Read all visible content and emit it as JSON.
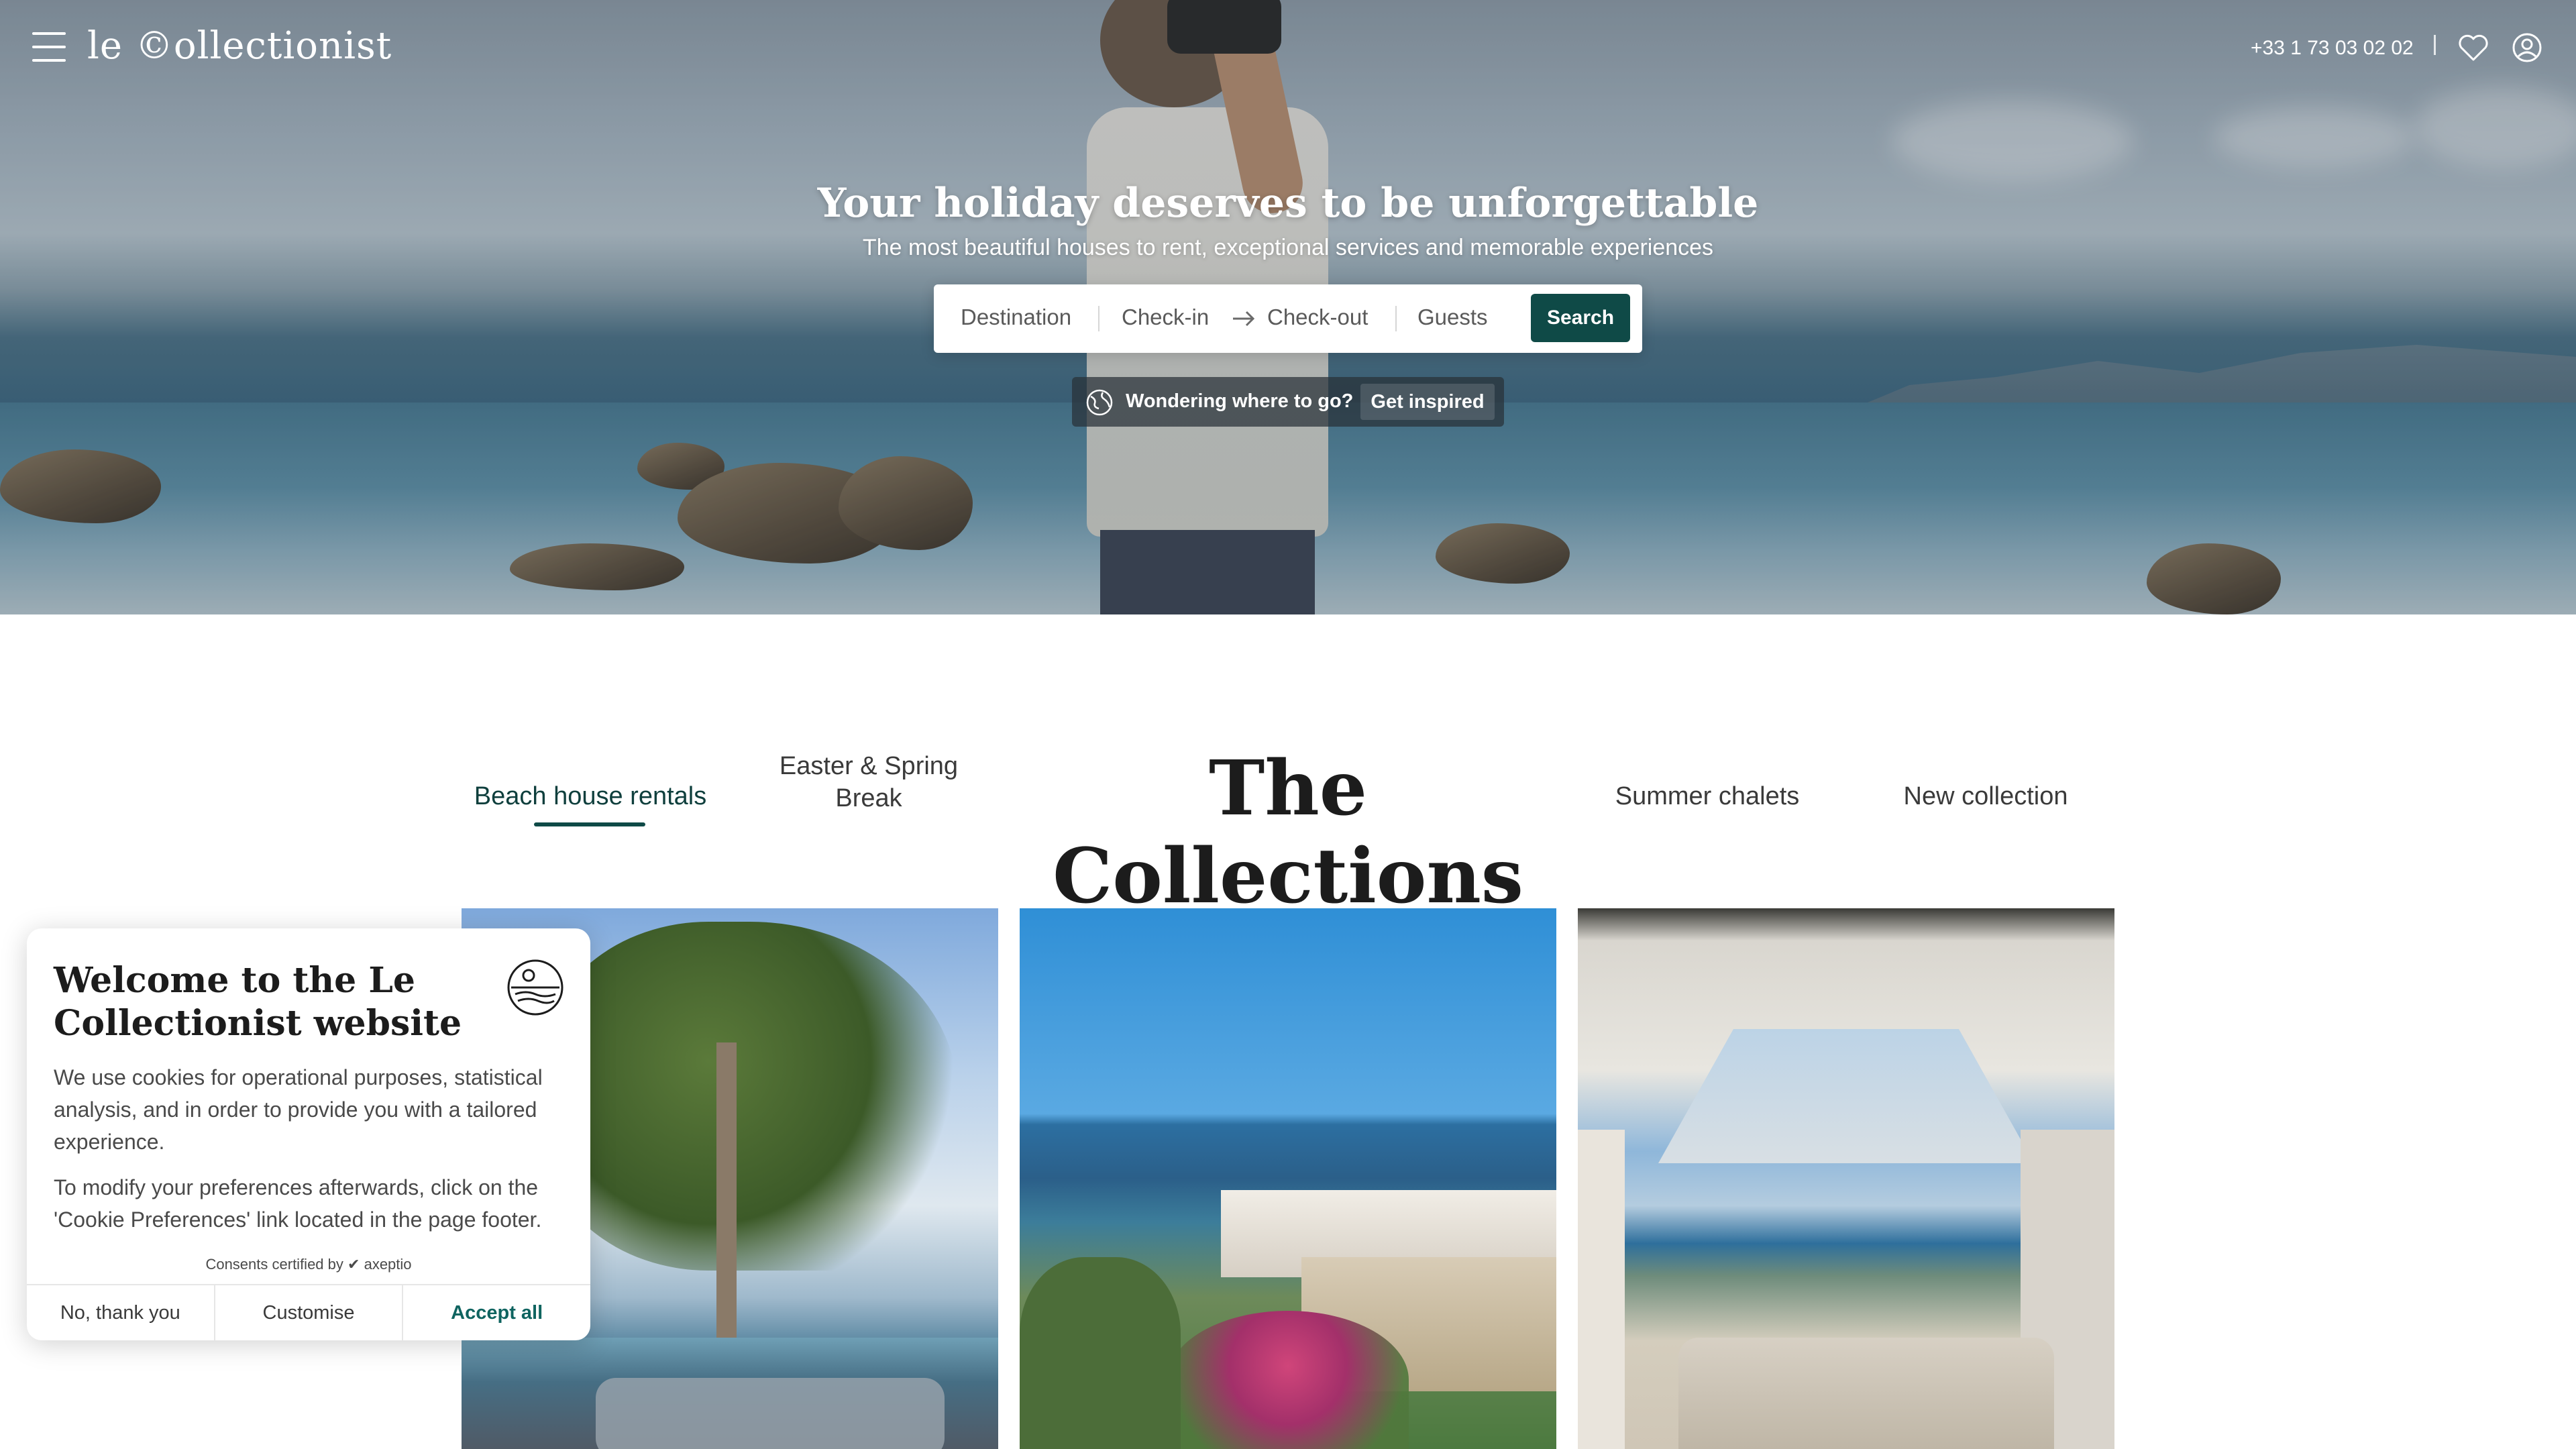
{
  "header": {
    "logo": "le ©ollectionist",
    "phone": "+33 1 73 03 02 02",
    "icons": [
      "menu-icon",
      "heart-icon",
      "user-icon"
    ]
  },
  "hero": {
    "title": "Your holiday deserves to be unforgettable",
    "subtitle": "The most beautiful houses to rent, exceptional services and memorable experiences",
    "search": {
      "destination_placeholder": "Destination",
      "checkin_placeholder": "Check-in",
      "checkout_placeholder": "Check-out",
      "guests_placeholder": "Guests",
      "button_label": "Search"
    },
    "inspire": {
      "text": "Wondering where to go?",
      "button_label": "Get inspired"
    }
  },
  "collections": {
    "title": "The Collections",
    "tabs": [
      {
        "label": "Beach house rentals",
        "active": true
      },
      {
        "label": "Easter & Spring Break",
        "active": false
      },
      {
        "label": "Summer chalets",
        "active": false
      },
      {
        "label": "New collection",
        "active": false
      }
    ]
  },
  "cookie_banner": {
    "title": "Welcome to the Le Collectionist website",
    "text1": "We use cookies for operational purposes, statistical analysis, and in order to provide you with a tailored experience.",
    "text2": "To modify your preferences afterwards, click on the 'Cookie Preferences' link located in the page footer.",
    "certified": "Consents certified by",
    "certifier": "axeptio",
    "buttons": {
      "decline": "No, thank you",
      "customise": "Customise",
      "accept": "Accept all"
    }
  },
  "colors": {
    "brand_green": "#0f4a47",
    "accent_link": "#0f6460"
  }
}
